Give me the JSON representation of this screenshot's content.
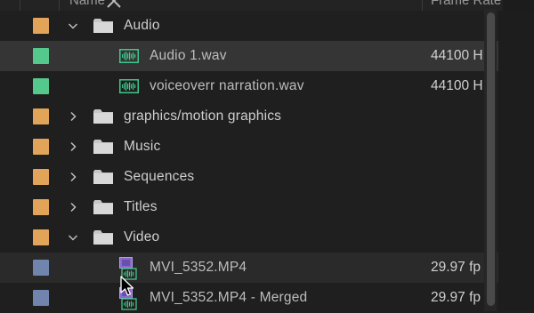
{
  "header": {
    "name_label": "Name",
    "frame_rate_label": "Frame Rate"
  },
  "colors": {
    "folder_swatch": "#e2a458",
    "audio_swatch": "#55c98b",
    "video_swatch": "#7184ad",
    "audio_icon": "#3cc98b",
    "video_icon": "#8a6ac8"
  },
  "rows": [
    {
      "label": "Audio",
      "type": "folder",
      "expanded": true,
      "icon": "folder-icon",
      "frame_rate": ""
    },
    {
      "label": "Audio 1.wav",
      "type": "audio",
      "icon": "audio-clip-icon",
      "frame_rate": "44100 H",
      "selected": true
    },
    {
      "label": "voiceoverr narration.wav",
      "type": "audio",
      "icon": "audio-clip-icon",
      "frame_rate": "44100 H"
    },
    {
      "label": "graphics/motion graphics",
      "type": "folder",
      "expanded": false,
      "icon": "folder-icon",
      "frame_rate": ""
    },
    {
      "label": "Music",
      "type": "folder",
      "expanded": false,
      "icon": "folder-icon",
      "frame_rate": ""
    },
    {
      "label": "Sequences",
      "type": "folder",
      "expanded": false,
      "icon": "folder-icon",
      "frame_rate": ""
    },
    {
      "label": "Titles",
      "type": "folder",
      "expanded": false,
      "icon": "folder-icon",
      "frame_rate": ""
    },
    {
      "label": "Video",
      "type": "folder",
      "expanded": true,
      "icon": "folder-icon",
      "frame_rate": ""
    },
    {
      "label": "MVI_5352.MP4",
      "type": "video",
      "icon": "video-clip-icon",
      "frame_rate": "29.97 fp",
      "hover": true
    },
    {
      "label": "MVI_5352.MP4 - Merged",
      "type": "video",
      "icon": "merged-clip-icon",
      "frame_rate": "29.97 fp"
    }
  ]
}
